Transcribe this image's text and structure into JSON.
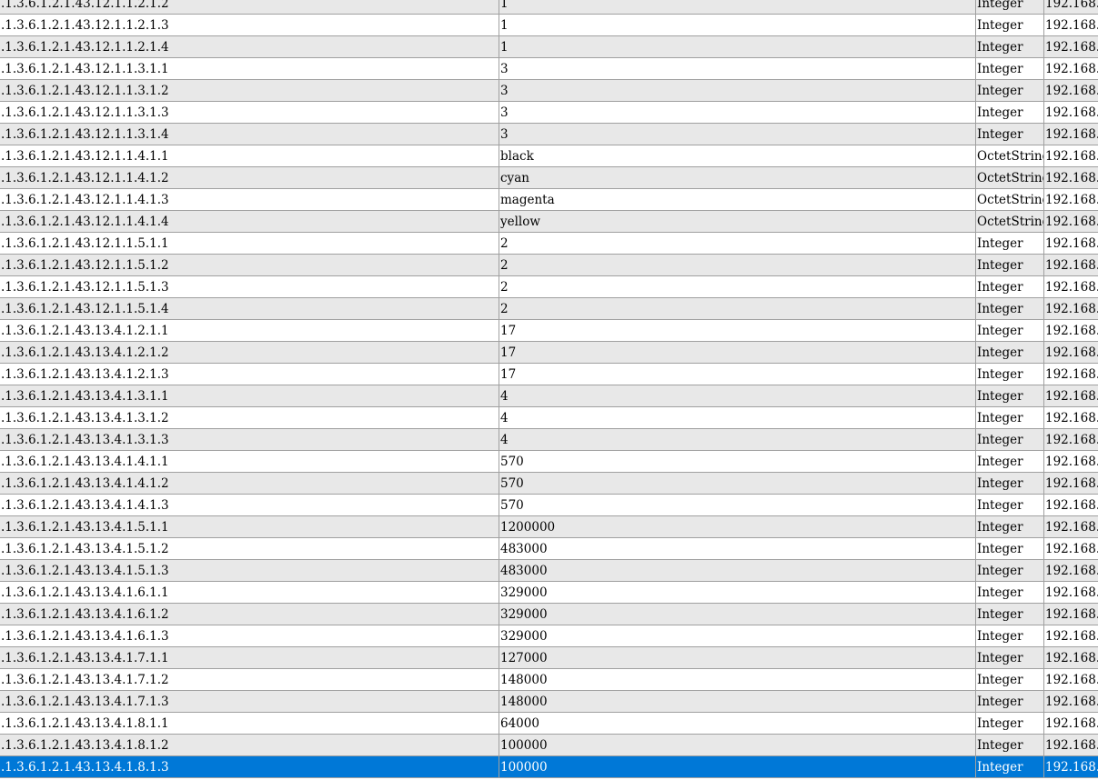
{
  "table": {
    "rows": [
      {
        "oid": ".1.3.6.1.2.1.43.12.1.1.2.1.2",
        "value": "1",
        "type": "Integer",
        "host": "192.168."
      },
      {
        "oid": ".1.3.6.1.2.1.43.12.1.1.2.1.3",
        "value": "1",
        "type": "Integer",
        "host": "192.168."
      },
      {
        "oid": ".1.3.6.1.2.1.43.12.1.1.2.1.4",
        "value": "1",
        "type": "Integer",
        "host": "192.168."
      },
      {
        "oid": ".1.3.6.1.2.1.43.12.1.1.3.1.1",
        "value": "3",
        "type": "Integer",
        "host": "192.168."
      },
      {
        "oid": ".1.3.6.1.2.1.43.12.1.1.3.1.2",
        "value": "3",
        "type": "Integer",
        "host": "192.168."
      },
      {
        "oid": ".1.3.6.1.2.1.43.12.1.1.3.1.3",
        "value": "3",
        "type": "Integer",
        "host": "192.168."
      },
      {
        "oid": ".1.3.6.1.2.1.43.12.1.1.3.1.4",
        "value": "3",
        "type": "Integer",
        "host": "192.168."
      },
      {
        "oid": ".1.3.6.1.2.1.43.12.1.1.4.1.1",
        "value": "black",
        "type": "OctetString",
        "host": "192.168."
      },
      {
        "oid": ".1.3.6.1.2.1.43.12.1.1.4.1.2",
        "value": "cyan",
        "type": "OctetString",
        "host": "192.168."
      },
      {
        "oid": ".1.3.6.1.2.1.43.12.1.1.4.1.3",
        "value": "magenta",
        "type": "OctetString",
        "host": "192.168."
      },
      {
        "oid": ".1.3.6.1.2.1.43.12.1.1.4.1.4",
        "value": "yellow",
        "type": "OctetString",
        "host": "192.168."
      },
      {
        "oid": ".1.3.6.1.2.1.43.12.1.1.5.1.1",
        "value": "2",
        "type": "Integer",
        "host": "192.168."
      },
      {
        "oid": ".1.3.6.1.2.1.43.12.1.1.5.1.2",
        "value": "2",
        "type": "Integer",
        "host": "192.168."
      },
      {
        "oid": ".1.3.6.1.2.1.43.12.1.1.5.1.3",
        "value": "2",
        "type": "Integer",
        "host": "192.168."
      },
      {
        "oid": ".1.3.6.1.2.1.43.12.1.1.5.1.4",
        "value": "2",
        "type": "Integer",
        "host": "192.168."
      },
      {
        "oid": ".1.3.6.1.2.1.43.13.4.1.2.1.1",
        "value": "17",
        "type": "Integer",
        "host": "192.168."
      },
      {
        "oid": ".1.3.6.1.2.1.43.13.4.1.2.1.2",
        "value": "17",
        "type": "Integer",
        "host": "192.168."
      },
      {
        "oid": ".1.3.6.1.2.1.43.13.4.1.2.1.3",
        "value": "17",
        "type": "Integer",
        "host": "192.168."
      },
      {
        "oid": ".1.3.6.1.2.1.43.13.4.1.3.1.1",
        "value": "4",
        "type": "Integer",
        "host": "192.168."
      },
      {
        "oid": ".1.3.6.1.2.1.43.13.4.1.3.1.2",
        "value": "4",
        "type": "Integer",
        "host": "192.168."
      },
      {
        "oid": ".1.3.6.1.2.1.43.13.4.1.3.1.3",
        "value": "4",
        "type": "Integer",
        "host": "192.168."
      },
      {
        "oid": ".1.3.6.1.2.1.43.13.4.1.4.1.1",
        "value": "570",
        "type": "Integer",
        "host": "192.168."
      },
      {
        "oid": ".1.3.6.1.2.1.43.13.4.1.4.1.2",
        "value": "570",
        "type": "Integer",
        "host": "192.168."
      },
      {
        "oid": ".1.3.6.1.2.1.43.13.4.1.4.1.3",
        "value": "570",
        "type": "Integer",
        "host": "192.168."
      },
      {
        "oid": ".1.3.6.1.2.1.43.13.4.1.5.1.1",
        "value": "1200000",
        "type": "Integer",
        "host": "192.168."
      },
      {
        "oid": ".1.3.6.1.2.1.43.13.4.1.5.1.2",
        "value": "483000",
        "type": "Integer",
        "host": "192.168."
      },
      {
        "oid": ".1.3.6.1.2.1.43.13.4.1.5.1.3",
        "value": "483000",
        "type": "Integer",
        "host": "192.168."
      },
      {
        "oid": ".1.3.6.1.2.1.43.13.4.1.6.1.1",
        "value": "329000",
        "type": "Integer",
        "host": "192.168."
      },
      {
        "oid": ".1.3.6.1.2.1.43.13.4.1.6.1.2",
        "value": "329000",
        "type": "Integer",
        "host": "192.168."
      },
      {
        "oid": ".1.3.6.1.2.1.43.13.4.1.6.1.3",
        "value": "329000",
        "type": "Integer",
        "host": "192.168."
      },
      {
        "oid": ".1.3.6.1.2.1.43.13.4.1.7.1.1",
        "value": "127000",
        "type": "Integer",
        "host": "192.168."
      },
      {
        "oid": ".1.3.6.1.2.1.43.13.4.1.7.1.2",
        "value": "148000",
        "type": "Integer",
        "host": "192.168."
      },
      {
        "oid": ".1.3.6.1.2.1.43.13.4.1.7.1.3",
        "value": "148000",
        "type": "Integer",
        "host": "192.168."
      },
      {
        "oid": ".1.3.6.1.2.1.43.13.4.1.8.1.1",
        "value": "64000",
        "type": "Integer",
        "host": "192.168."
      },
      {
        "oid": ".1.3.6.1.2.1.43.13.4.1.8.1.2",
        "value": "100000",
        "type": "Integer",
        "host": "192.168."
      },
      {
        "oid": ".1.3.6.1.2.1.43.13.4.1.8.1.3",
        "value": "100000",
        "type": "Integer",
        "host": "192.168.",
        "selected": true
      }
    ]
  },
  "colors": {
    "row_alt": "#e8e8e8",
    "row_white": "#ffffff",
    "selection": "#0078d7",
    "grid_line": "#a0a0a0"
  }
}
